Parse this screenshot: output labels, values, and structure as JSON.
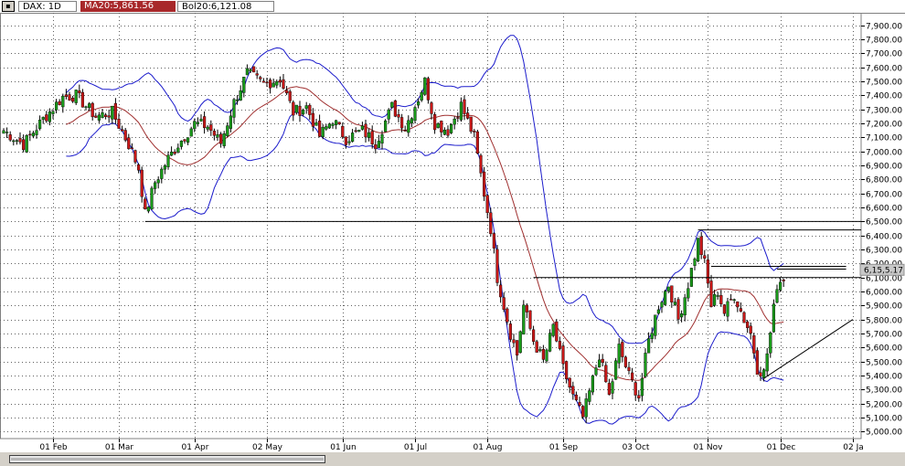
{
  "header": {
    "window_icon": "chart-window-icon",
    "symbol": "DAX: 1D",
    "ma_label": "MA20:5,861.56",
    "bollinger_label": "Bol20:6,121.08"
  },
  "colors": {
    "up": "#1a9a1a",
    "down": "#c81818",
    "ma": "#a03030",
    "bollinger": "#1c1ccc",
    "level_lines": "#000000",
    "price_marker": "#c8c8c8"
  },
  "chart_data": {
    "type": "candlestick",
    "title": "",
    "ylim": [
      4950,
      7990
    ],
    "yticks": [
      5000,
      5100,
      5200,
      5300,
      5400,
      5500,
      5600,
      5700,
      5800,
      5900,
      6000,
      6100,
      6200,
      6300,
      6400,
      6500,
      6600,
      6700,
      6800,
      6900,
      7000,
      7100,
      7200,
      7300,
      7400,
      7500,
      7600,
      7700,
      7800,
      7900
    ],
    "ytick_labels": [
      "5,000.00",
      "5,100.00",
      "5,200.00",
      "5,300.00",
      "5,400.00",
      "5,500.00",
      "5,600.00",
      "5,700.00",
      "5,800.00",
      "5,900.00",
      "6,000.00",
      "6,100.00",
      "6,200.00",
      "6,300.00",
      "6,400.00",
      "6,500.00",
      "6,600.00",
      "6,700.00",
      "6,800.00",
      "6,900.00",
      "7,000.00",
      "7,100.00",
      "7,200.00",
      "7,300.00",
      "7,400.00",
      "7,500.00",
      "7,600.00",
      "7,700.00",
      "7,800.00",
      "7,900.00"
    ],
    "n_bars": 238,
    "xticks": [
      {
        "bar": 15,
        "label": "01 Feb"
      },
      {
        "bar": 35,
        "label": "01 Mar"
      },
      {
        "bar": 58,
        "label": "01 Apr"
      },
      {
        "bar": 80,
        "label": "02 May"
      },
      {
        "bar": 103,
        "label": "01 Jun"
      },
      {
        "bar": 125,
        "label": "01 Jul"
      },
      {
        "bar": 147,
        "label": "01 Aug"
      },
      {
        "bar": 170,
        "label": "01 Sep"
      },
      {
        "bar": 192,
        "label": "03 Oct"
      },
      {
        "bar": 214,
        "label": "01 Nov"
      },
      {
        "bar": 236,
        "label": "01 Dec"
      },
      {
        "bar": 258,
        "label": "02 Ja"
      }
    ],
    "price_anchors": [
      {
        "bar": 0,
        "close": 7150
      },
      {
        "bar": 6,
        "close": 7050
      },
      {
        "bar": 12,
        "close": 7230
      },
      {
        "bar": 18,
        "close": 7390
      },
      {
        "bar": 22,
        "close": 7400
      },
      {
        "bar": 28,
        "close": 7250
      },
      {
        "bar": 33,
        "close": 7280
      },
      {
        "bar": 38,
        "close": 7050
      },
      {
        "bar": 41,
        "close": 6880
      },
      {
        "bar": 43,
        "close": 6550
      },
      {
        "bar": 46,
        "close": 6780
      },
      {
        "bar": 50,
        "close": 6950
      },
      {
        "bar": 53,
        "close": 7050
      },
      {
        "bar": 58,
        "close": 7200
      },
      {
        "bar": 62,
        "close": 7180
      },
      {
        "bar": 66,
        "close": 7060
      },
      {
        "bar": 70,
        "close": 7350
      },
      {
        "bar": 74,
        "close": 7560
      },
      {
        "bar": 79,
        "close": 7480
      },
      {
        "bar": 84,
        "close": 7520
      },
      {
        "bar": 88,
        "close": 7280
      },
      {
        "bar": 92,
        "close": 7320
      },
      {
        "bar": 96,
        "close": 7110
      },
      {
        "bar": 100,
        "close": 7230
      },
      {
        "bar": 104,
        "close": 7090
      },
      {
        "bar": 109,
        "close": 7150
      },
      {
        "bar": 113,
        "close": 7060
      },
      {
        "bar": 118,
        "close": 7320
      },
      {
        "bar": 122,
        "close": 7170
      },
      {
        "bar": 126,
        "close": 7380
      },
      {
        "bar": 128,
        "close": 7500
      },
      {
        "bar": 131,
        "close": 7200
      },
      {
        "bar": 135,
        "close": 7150
      },
      {
        "bar": 139,
        "close": 7330
      },
      {
        "bar": 143,
        "close": 7100
      },
      {
        "bar": 146,
        "close": 6700
      },
      {
        "bar": 148,
        "close": 6450
      },
      {
        "bar": 150,
        "close": 6100
      },
      {
        "bar": 152,
        "close": 5900
      },
      {
        "bar": 154,
        "close": 5700
      },
      {
        "bar": 156,
        "close": 5550
      },
      {
        "bar": 158,
        "close": 5900
      },
      {
        "bar": 161,
        "close": 5650
      },
      {
        "bar": 164,
        "close": 5500
      },
      {
        "bar": 167,
        "close": 5750
      },
      {
        "bar": 170,
        "close": 5450
      },
      {
        "bar": 173,
        "close": 5250
      },
      {
        "bar": 176,
        "close": 5100
      },
      {
        "bar": 178,
        "close": 5280
      },
      {
        "bar": 181,
        "close": 5550
      },
      {
        "bar": 184,
        "close": 5250
      },
      {
        "bar": 187,
        "close": 5600
      },
      {
        "bar": 190,
        "close": 5400
      },
      {
        "bar": 193,
        "close": 5250
      },
      {
        "bar": 196,
        "close": 5650
      },
      {
        "bar": 199,
        "close": 5900
      },
      {
        "bar": 202,
        "close": 6050
      },
      {
        "bar": 205,
        "close": 5800
      },
      {
        "bar": 208,
        "close": 6050
      },
      {
        "bar": 211,
        "close": 6360
      },
      {
        "bar": 213,
        "close": 6200
      },
      {
        "bar": 215,
        "close": 5900
      },
      {
        "bar": 217,
        "close": 6000
      },
      {
        "bar": 219,
        "close": 5850
      },
      {
        "bar": 222,
        "close": 5980
      },
      {
        "bar": 225,
        "close": 5800
      },
      {
        "bar": 227,
        "close": 5700
      },
      {
        "bar": 229,
        "close": 5450
      },
      {
        "bar": 231,
        "close": 5420
      },
      {
        "bar": 233,
        "close": 5700
      },
      {
        "bar": 235,
        "close": 6050
      },
      {
        "bar": 237,
        "close": 6100
      },
      {
        "bar": 239,
        "close": 5980
      },
      {
        "bar": 241,
        "close": 5850
      },
      {
        "bar": 244,
        "close": 5720
      },
      {
        "bar": 247,
        "close": 5900
      },
      {
        "bar": 250,
        "close": 5800
      },
      {
        "bar": 253,
        "close": 5850
      },
      {
        "bar": 256,
        "close": 6080
      }
    ],
    "horizontal_lines": [
      {
        "price": 6500,
        "from_bar": 43,
        "to_bar": 261
      },
      {
        "price": 6440,
        "from_bar": 211,
        "to_bar": 261
      },
      {
        "price": 6100,
        "from_bar": 161,
        "to_bar": 261
      },
      {
        "price": 6180,
        "from_bar": 215,
        "to_bar": 256
      },
      {
        "price": 6160,
        "from_bar": 235,
        "to_bar": 256
      }
    ],
    "trendline": {
      "from_bar": 231,
      "from_price": 5380,
      "to_bar": 258,
      "to_price": 5800
    },
    "last_price_marker": "6,15,5.17",
    "ma_period": 20,
    "bollinger_period": 20
  }
}
